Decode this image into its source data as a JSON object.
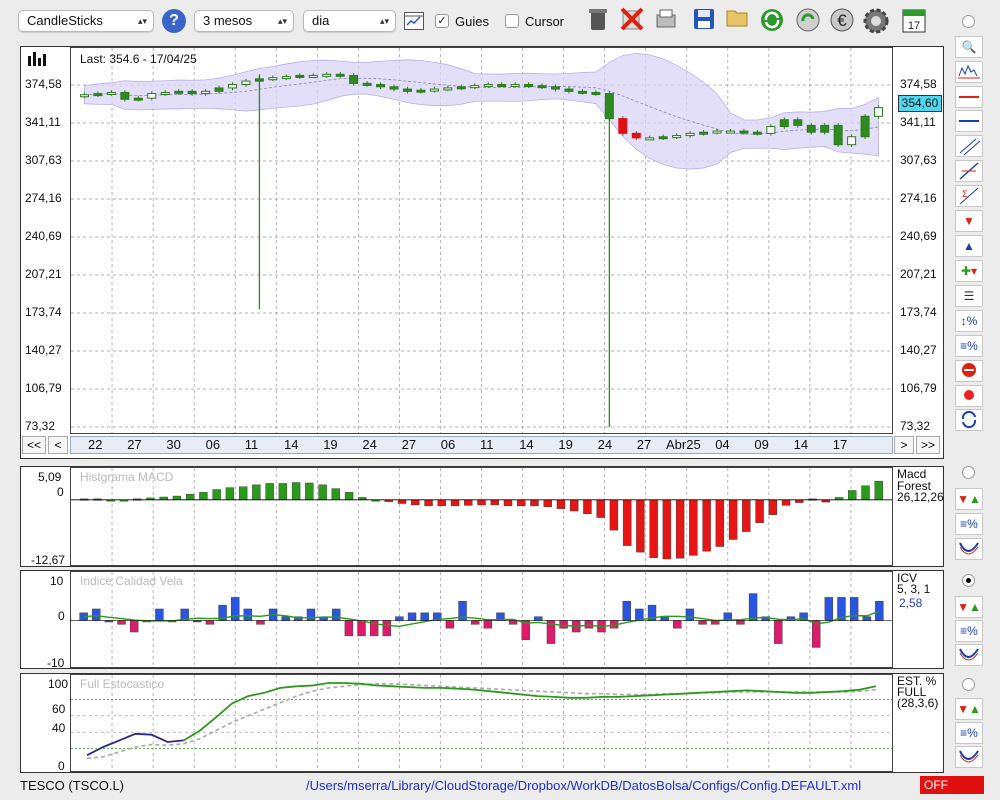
{
  "toolbar": {
    "chart_type": "CandleSticks",
    "period": "3 mesos",
    "interval": "dia",
    "guides_label": "Guies",
    "cursor_label": "Cursor",
    "help_glyph": "?",
    "calendar_day": "17"
  },
  "main_chart": {
    "last_label": "Last: 354.6 - 17/04/25",
    "current_price_badge": "354,60",
    "y_ticks": [
      "374,58",
      "341,11",
      "307,63",
      "274,16",
      "240,69",
      "207,21",
      "173,74",
      "140,27",
      "106,79",
      "73,32"
    ],
    "x_dates": [
      "22",
      "27",
      "30",
      "06",
      "11",
      "14",
      "19",
      "24",
      "27",
      "06",
      "11",
      "14",
      "19",
      "24",
      "27",
      "Abr25",
      "04",
      "09",
      "14",
      "17"
    ],
    "nav": {
      "first": "<<",
      "prev": "<",
      "next": ">",
      "last": ">>"
    }
  },
  "chart_data": [
    {
      "type": "candlestick",
      "title": "Last: 354.6 - 17/04/25",
      "ylim": [
        73.32,
        374.58
      ],
      "y_ticks": [
        374.58,
        341.11,
        307.63,
        274.16,
        240.69,
        207.21,
        173.74,
        140.27,
        106.79,
        73.32
      ],
      "bar_count": 60,
      "closes": [
        366,
        367,
        368,
        362,
        363,
        367,
        368,
        369,
        367,
        369,
        372,
        375,
        378,
        380,
        381,
        382,
        383,
        383,
        384,
        383,
        376,
        375,
        373,
        371,
        369,
        370,
        371,
        372,
        373,
        374,
        375,
        375,
        375,
        374,
        373,
        371,
        369,
        368,
        367,
        345,
        332,
        328,
        328,
        329,
        330,
        332,
        333,
        334,
        334,
        333,
        332,
        338,
        344,
        339,
        333,
        339,
        322,
        329,
        347,
        354.6
      ],
      "spikes": [
        {
          "index": 13,
          "low": 177
        },
        {
          "index": 39,
          "low": 73.32
        }
      ],
      "indicators": [
        "Bollinger band",
        "moving average"
      ]
    },
    {
      "type": "bar",
      "title": "Histgrama MACD",
      "ylim": [
        -12.67,
        5.09
      ],
      "y_ticks": [
        5.09,
        0,
        -12.67
      ],
      "legend": [
        "Macd",
        "Forest",
        "26,12,26"
      ],
      "values": [
        0.2,
        0.2,
        0,
        0,
        0.2,
        0.4,
        0.6,
        0.8,
        1.2,
        1.6,
        2.2,
        2.6,
        2.8,
        3.2,
        3.5,
        3.5,
        3.7,
        3.6,
        3.2,
        2.4,
        1.6,
        0.5,
        0,
        -0.4,
        -0.8,
        -1.1,
        -1.3,
        -1.3,
        -1.3,
        -1.2,
        -1.1,
        -1.1,
        -1.3,
        -1.3,
        -1.3,
        -1.5,
        -1.9,
        -2.4,
        -3.0,
        -3.8,
        -6.5,
        -9.8,
        -11.2,
        -12.4,
        -12.67,
        -12.5,
        -11.9,
        -11.0,
        -10.0,
        -8.5,
        -6.8,
        -4.9,
        -3.2,
        -1.2,
        -0.6,
        0.2,
        -0.5,
        0.5,
        2.0,
        3.0,
        4.0
      ]
    },
    {
      "type": "bar",
      "title": "Indice Calidad Vela",
      "ylim": [
        -10,
        10
      ],
      "y_ticks": [
        10,
        0,
        -10
      ],
      "legend": [
        "ICV",
        "5, 3, 1",
        "2,58"
      ],
      "values": [
        2,
        3,
        0,
        -1,
        -3,
        0,
        3,
        0,
        3,
        0,
        -1,
        4,
        6,
        3,
        -1,
        3,
        1,
        1,
        3,
        1,
        3,
        -4,
        -4,
        -4,
        -4,
        1,
        2,
        2,
        2,
        -2,
        5,
        -1,
        -2,
        2,
        -1,
        -5,
        1,
        -6,
        -2,
        -3,
        -2,
        -3,
        -2,
        5,
        3,
        4,
        1,
        -2,
        3,
        -1,
        -1,
        2,
        -1,
        7,
        1,
        -6,
        1,
        2,
        -7,
        6,
        6,
        6,
        1,
        5
      ],
      "series_value": 2.58
    },
    {
      "type": "line",
      "title": "Full Estocastico",
      "ylim": [
        0,
        100
      ],
      "y_ticks": [
        100,
        60,
        40,
        0
      ],
      "legend": [
        "EST. %",
        "FULL",
        "(28,3,6)"
      ],
      "series": [
        {
          "values": [
            12,
            22,
            30,
            38,
            37,
            28,
            30,
            42,
            58,
            75,
            84,
            88,
            94,
            96,
            97,
            100,
            100,
            99,
            97,
            96,
            95,
            94,
            94,
            93,
            92,
            90,
            88,
            86,
            84,
            83,
            82,
            82,
            83,
            83,
            84,
            85,
            86,
            87,
            88,
            89,
            90,
            91,
            90,
            89,
            88,
            88,
            89,
            90,
            92,
            96
          ]
        },
        {
          "values": [
            8,
            10,
            16,
            22,
            25,
            24,
            26,
            32,
            42,
            52,
            60,
            68,
            76,
            84,
            90,
            94,
            96,
            98,
            99,
            99,
            98,
            97,
            96,
            95,
            94,
            93,
            92,
            91,
            90,
            89,
            88,
            87,
            87,
            86,
            86,
            86,
            87,
            87,
            88,
            88,
            89,
            89,
            89,
            89,
            89,
            89,
            89,
            89,
            90,
            92
          ]
        }
      ]
    }
  ],
  "panels": {
    "macd": {
      "title": "Histgrama MACD",
      "y_ticks": [
        "5,09",
        "0",
        "-12,67"
      ],
      "legend": [
        "Macd",
        "Forest",
        "26,12,26"
      ]
    },
    "icv": {
      "title": "Indice Calidad Vela",
      "y_ticks": [
        "10",
        "0",
        "-10"
      ],
      "legend": [
        "ICV",
        "5, 3, 1"
      ],
      "value": "2,58"
    },
    "stoch": {
      "title": "Full Estocastico",
      "y_ticks": [
        "100",
        "60",
        "40",
        "0"
      ],
      "legend": [
        "EST. %",
        "FULL",
        "(28,3,6)"
      ]
    }
  },
  "status": {
    "symbol": "TESCO (TSCO.L)",
    "config_path": "/Users/mserra/Library/CloudStorage/Dropbox/WorkDB/DatosBolsa/Configs/Config.DEFAULT.xml",
    "state": "OFF"
  },
  "colors": {
    "up": "#2e8b1f",
    "down": "#e01010",
    "band": "#d9d4f7",
    "macd_pos": "#2a9a1a",
    "macd_neg": "#e81515",
    "icv_pos": "#2a55e0",
    "icv_neg": "#e01a6a",
    "stoch_main": "#2a9a1a",
    "stoch_signal": "#aaaaaa",
    "badge": "#4dd8f0"
  }
}
